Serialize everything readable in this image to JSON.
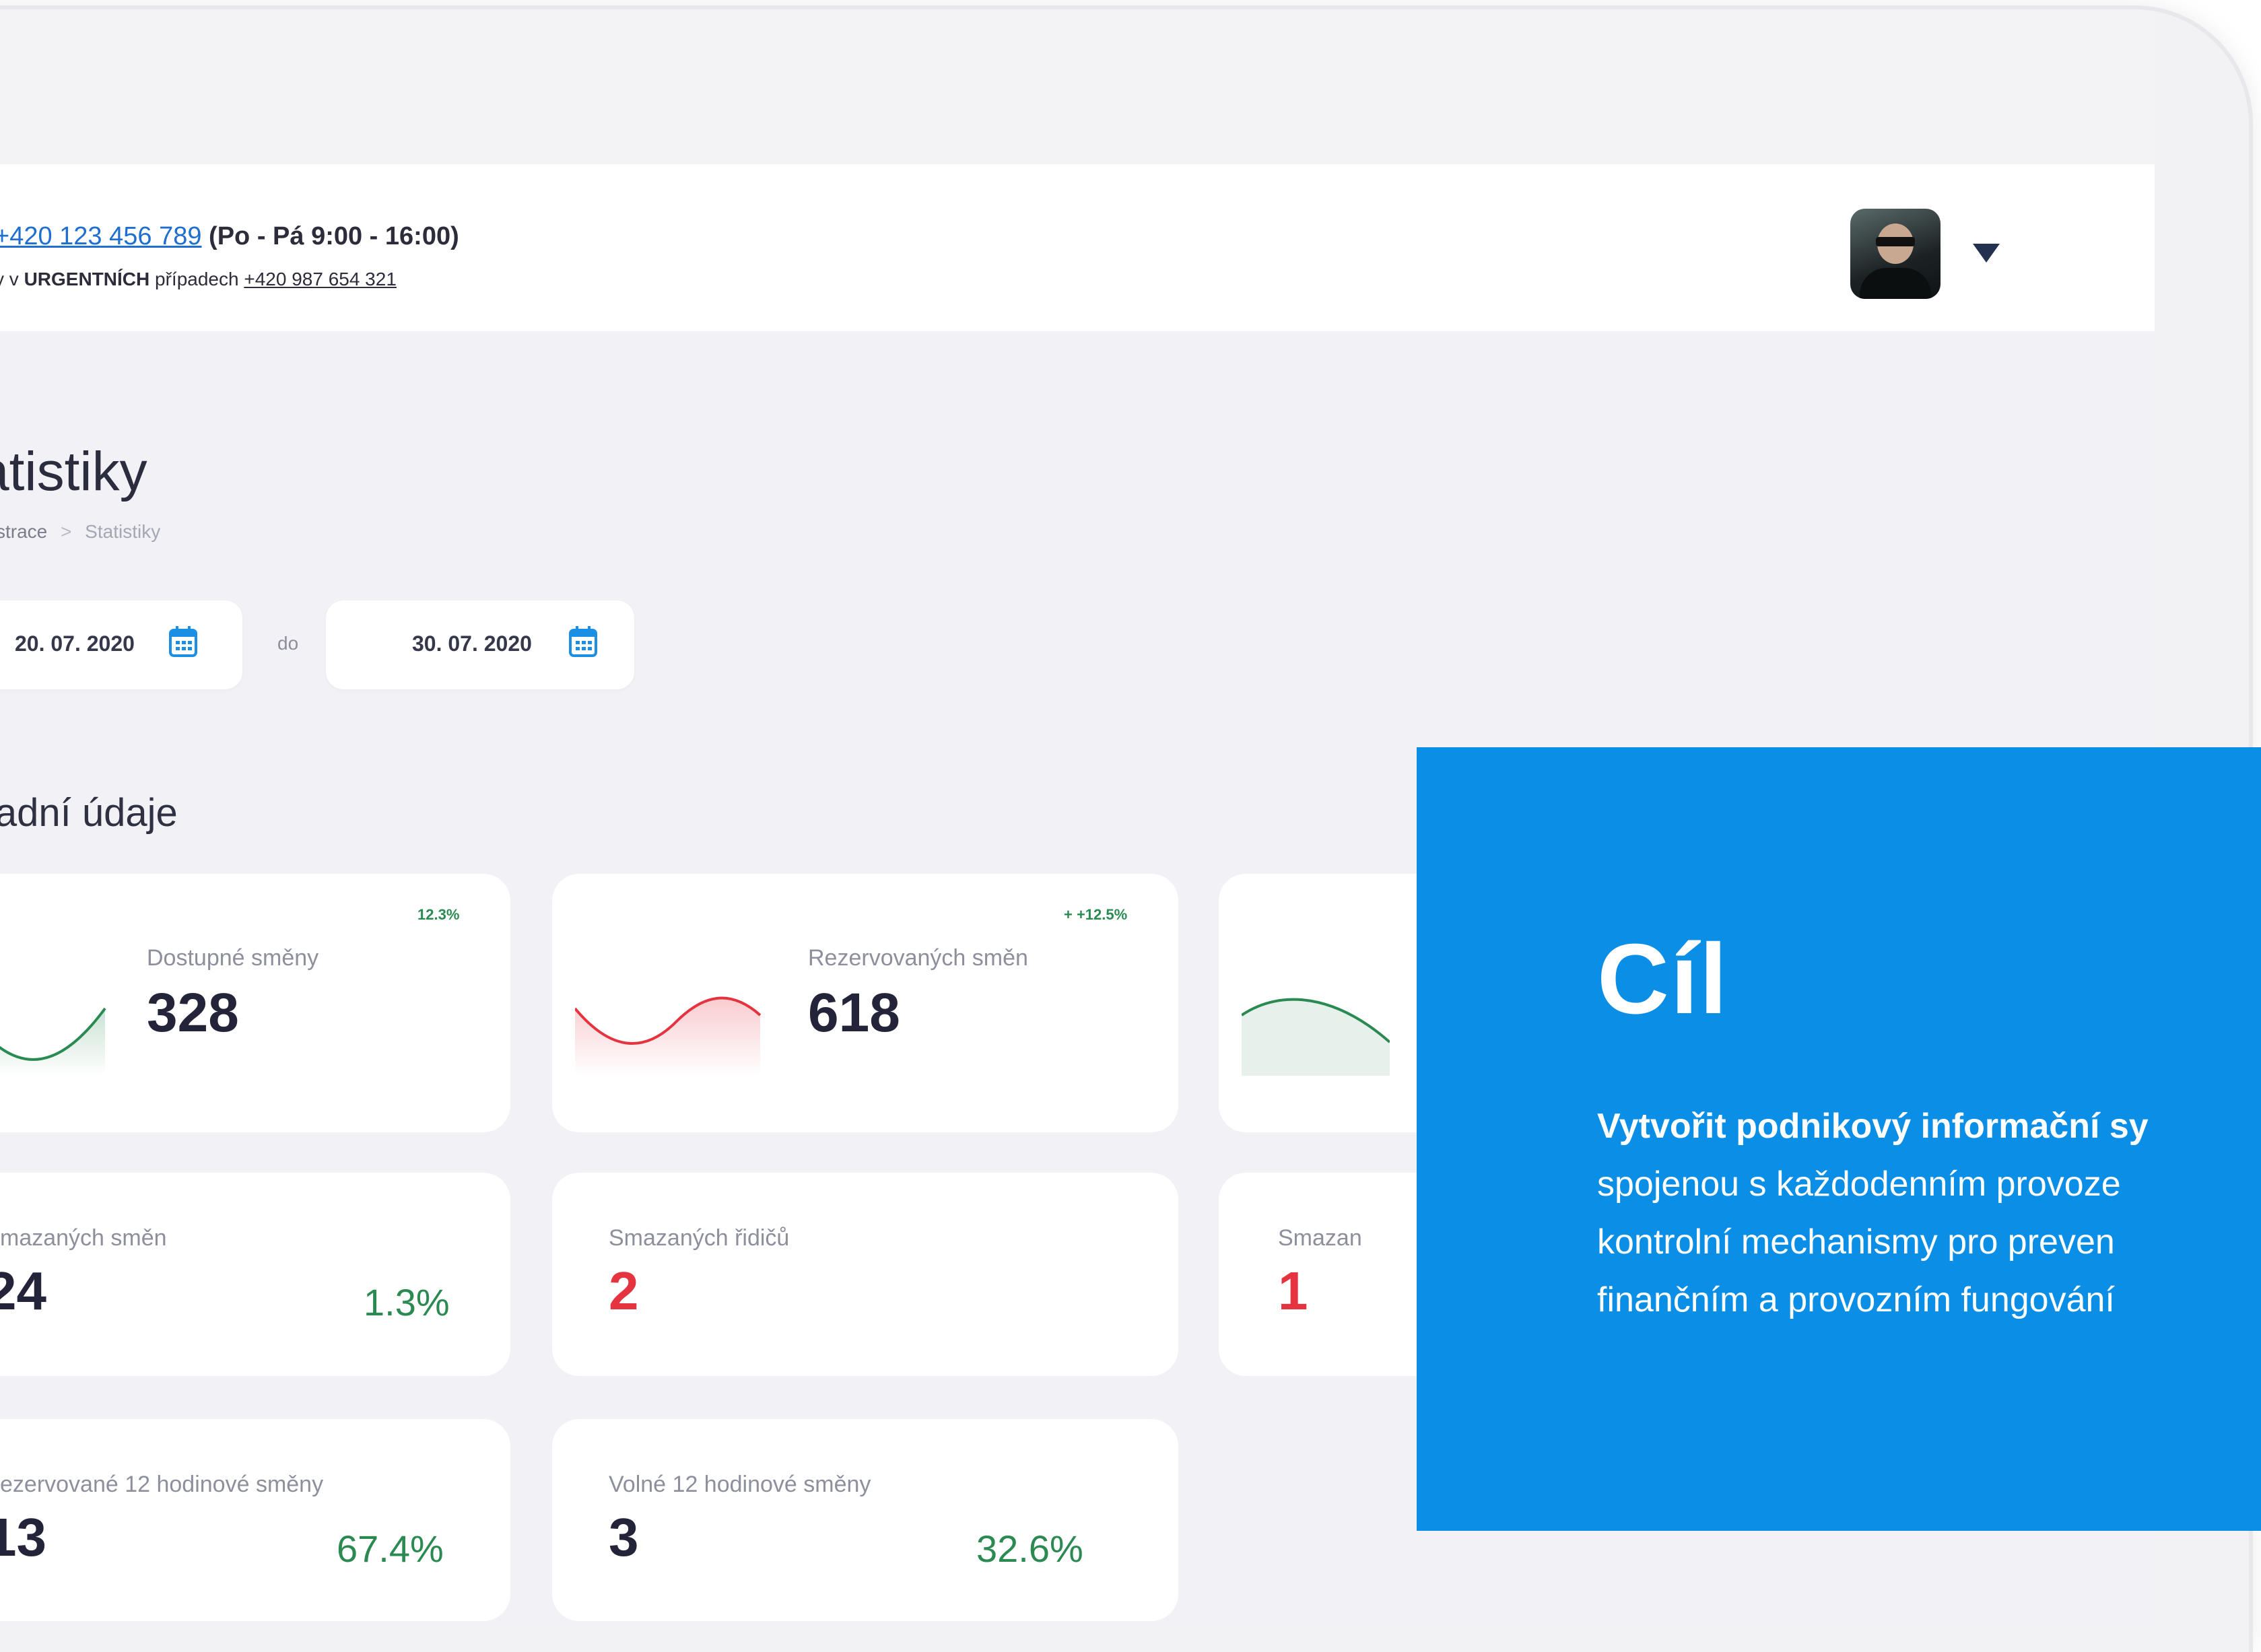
{
  "header": {
    "phone": "+420 123 456 789",
    "hours": "(Po - Pá 9:00 - 16:00)",
    "urgent_prefix": "y v",
    "urgent_bold": "URGENTNÍCH",
    "urgent_suffix": "případech",
    "urgent_phone": "+420 987 654 321"
  },
  "page": {
    "title": "atistiky",
    "breadcrumb_parent": "strace",
    "breadcrumb_sep": ">",
    "breadcrumb_current": "Statistiky"
  },
  "filters": {
    "date_from": "20. 07. 2020",
    "separator": "do",
    "date_to": "30. 07. 2020"
  },
  "section": {
    "title": "ladní údaje"
  },
  "cards": [
    {
      "label": "Dostupné směny",
      "value": "328",
      "change": "12.3%",
      "trend": "up",
      "color": "#2b8a52"
    },
    {
      "label": "Rezervovaných směn",
      "value": "618",
      "change": "+ +12.5%",
      "trend": "down",
      "color": "#e5343f"
    },
    {
      "label": "mazaných směn",
      "value": "24",
      "change": "1.3%"
    },
    {
      "label": "Smazaných řidičů",
      "value": "2"
    },
    {
      "label": "Smazan",
      "value": "1"
    },
    {
      "label": "ezervované 12 hodinové směny",
      "value": "13",
      "change": "67.4%"
    },
    {
      "label": "Volné 12 hodinové směny",
      "value": "3",
      "change": "32.6%"
    }
  ],
  "overlay": {
    "title": "Cíl",
    "line1_bold": "Vytvořit podnikový informační sy",
    "line2": "spojenou s každodenním provoze",
    "line3": "kontrolní mechanismy pro preven",
    "line4": "finančním a provozním fungování",
    "color": "#0a8ee6"
  },
  "icons": {
    "calendar": "calendar-icon",
    "caret": "chevron-down-icon",
    "avatar": "user-avatar"
  }
}
